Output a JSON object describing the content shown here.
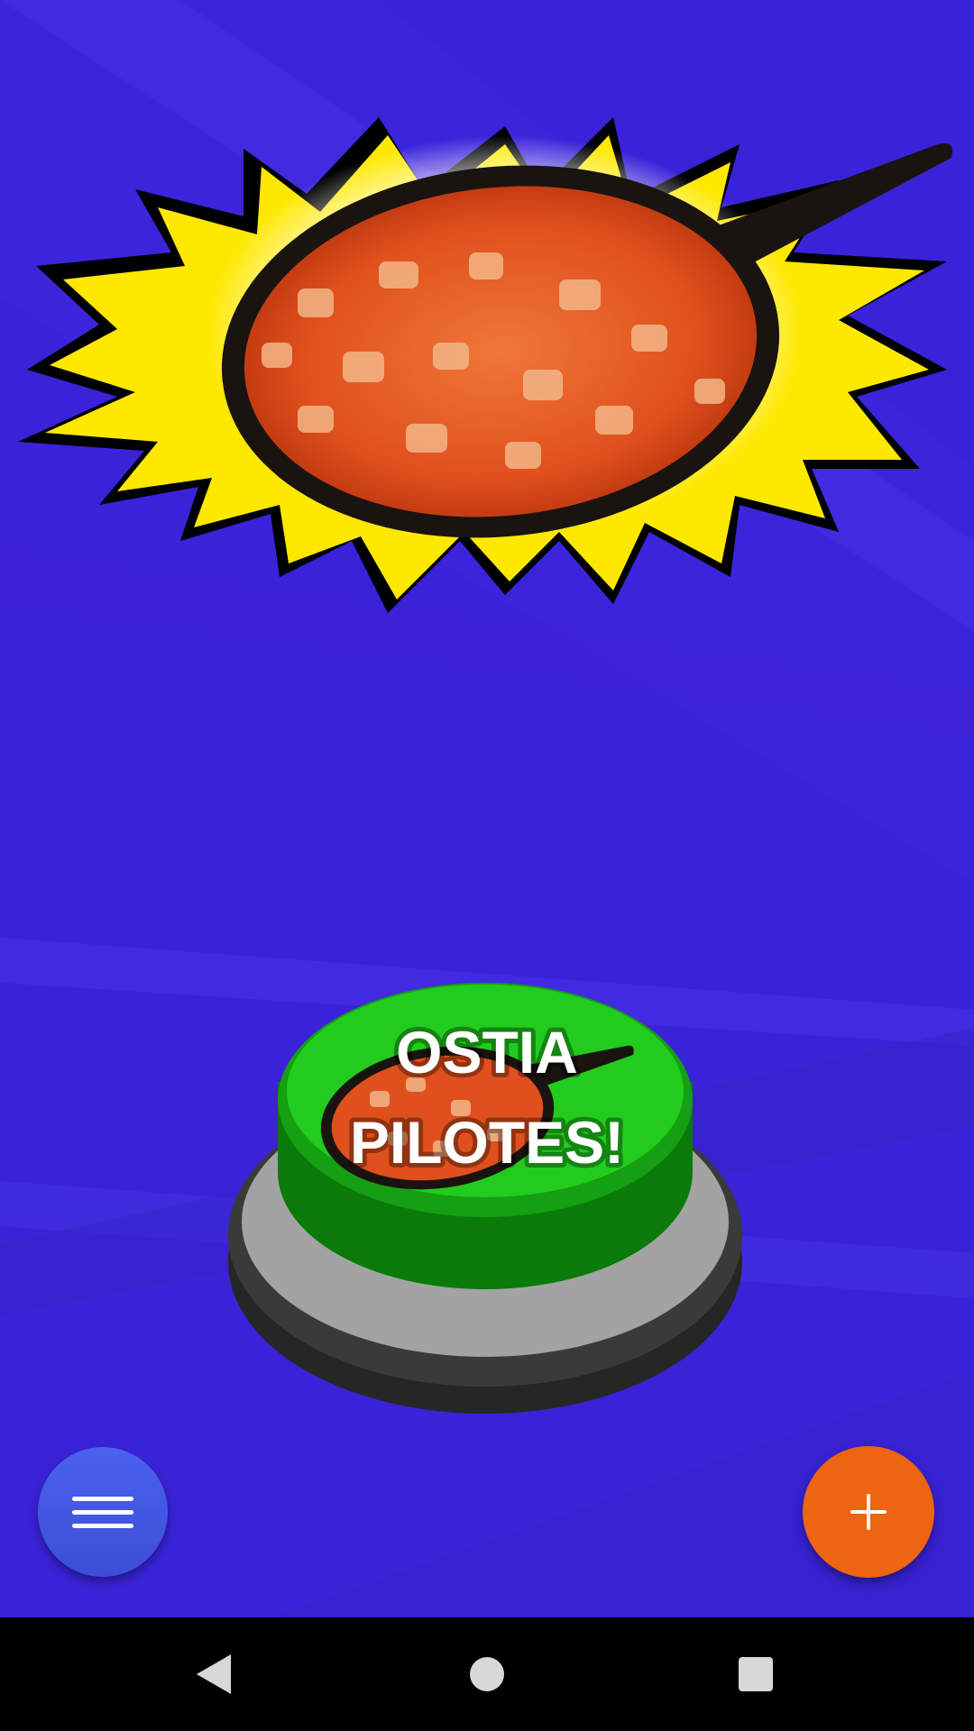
{
  "background": {
    "base_color": "#3a22d8",
    "ray_light": "#4a34e6",
    "ray_dark": "#3218c2"
  },
  "sound_image": {
    "subject": "frying-pan-with-stew",
    "burst_color": "#ffe800",
    "pan_color": "#1a1410",
    "stew_color": "#e9541e"
  },
  "sound_button": {
    "label_line1": "OSTIA",
    "label_line2": "PILOTES!",
    "button_color": "#22cc1e",
    "base_color": "#a3a3a3",
    "base_dark": "#2c2c2c"
  },
  "menu_button": {
    "icon": "hamburger-menu-icon",
    "color": "#4258e4"
  },
  "add_button": {
    "icon": "plus-icon",
    "color": "#ed6411"
  },
  "system_nav": {
    "back_icon": "back-triangle-icon",
    "home_icon": "home-circle-icon",
    "recents_icon": "recents-square-icon"
  }
}
